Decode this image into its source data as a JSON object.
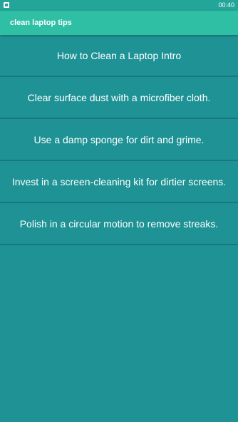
{
  "status_bar": {
    "time": "00:40",
    "notification_icon": "notification-icon"
  },
  "app_bar": {
    "title": "clean laptop tips"
  },
  "list": {
    "items": [
      {
        "label": "How to Clean a Laptop Intro"
      },
      {
        "label": "Clear surface dust with a microfiber cloth."
      },
      {
        "label": "Use a damp sponge for dirt and grime."
      },
      {
        "label": "Invest in a screen-cleaning kit for dirtier screens."
      },
      {
        "label": "Polish in a circular motion to remove streaks."
      }
    ]
  },
  "colors": {
    "status_bar": "#24a59a",
    "app_bar": "#2ebfa5",
    "background": "#1e9294",
    "divider": "#17797b",
    "text": "#ffffff"
  }
}
